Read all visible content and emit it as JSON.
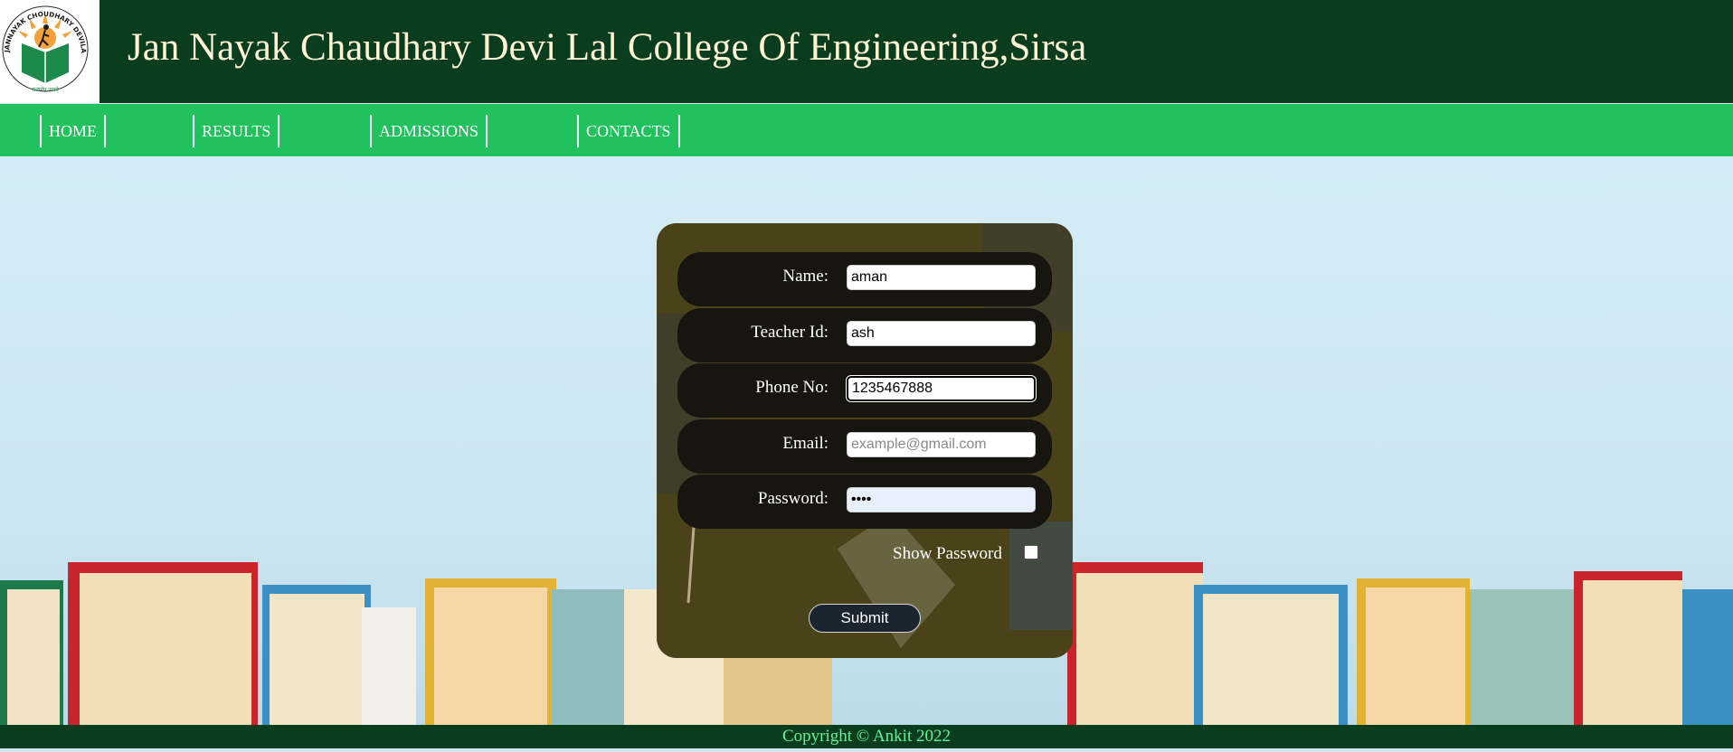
{
  "header": {
    "logo_text": "JANNAYAK CHOUDHARY DEVILAL VIDYA PEETH",
    "title": "Jan Nayak Chaudhary Devi Lal College Of Engineering,Sirsa"
  },
  "nav": {
    "items": [
      {
        "label": "HOME"
      },
      {
        "label": "RESULTS"
      },
      {
        "label": "ADMISSIONS"
      },
      {
        "label": "CONTACTS"
      }
    ]
  },
  "form": {
    "fields": [
      {
        "label": "Name:",
        "value": "aman",
        "placeholder": ""
      },
      {
        "label": "Teacher Id:",
        "value": "ash",
        "placeholder": ""
      },
      {
        "label": "Phone No:",
        "value": "1235467888",
        "placeholder": ""
      },
      {
        "label": "Email:",
        "value": "",
        "placeholder": "example@gmail.com"
      },
      {
        "label": "Password:",
        "value": "••••",
        "placeholder": ""
      }
    ],
    "show_password_label": "Show Password",
    "show_password_checked": false,
    "submit_label": "Submit"
  },
  "footer": {
    "copyright": "Copyright © Ankit 2022"
  },
  "colors": {
    "header_bg": "#0a3d1e",
    "nav_bg": "#21c25e",
    "title_text": "#fff3d6",
    "footer_text": "#62f29c",
    "card_bg": "#3b3517",
    "row_bg": "#171510",
    "submit_bg": "#1a2530"
  }
}
